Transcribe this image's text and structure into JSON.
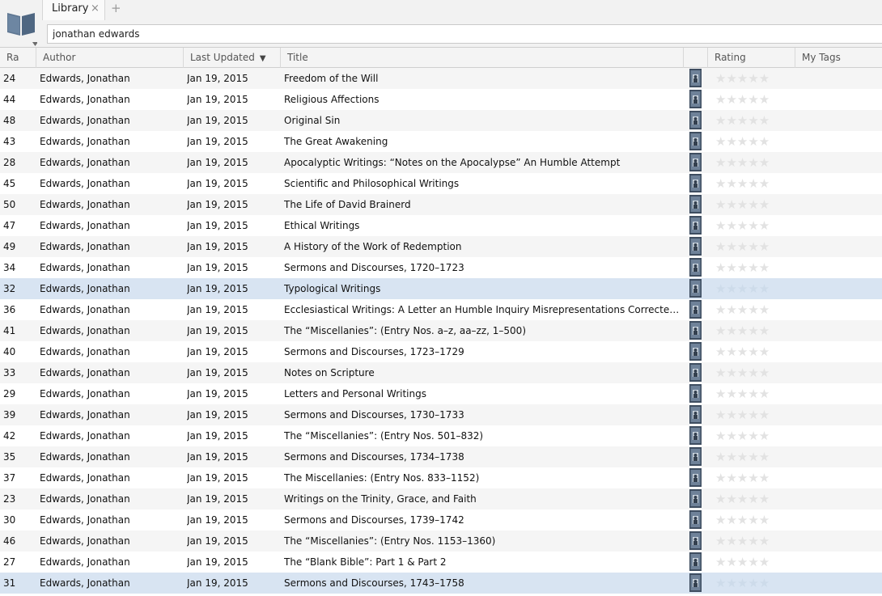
{
  "tabs": [
    {
      "label": "Library",
      "close": "×"
    }
  ],
  "tab_add": "+",
  "search": {
    "value": "jonathan edwards",
    "placeholder": ""
  },
  "columns": [
    {
      "key": "rank",
      "label": "Ra"
    },
    {
      "key": "author",
      "label": "Author"
    },
    {
      "key": "updated",
      "label": "Last Updated",
      "sort": "▼"
    },
    {
      "key": "title",
      "label": "Title"
    },
    {
      "key": "cover",
      "label": ""
    },
    {
      "key": "rating",
      "label": "Rating"
    },
    {
      "key": "tags",
      "label": "My Tags"
    }
  ],
  "stars": "★★★★★",
  "rows": [
    {
      "rank": "24",
      "author": "Edwards, Jonathan",
      "updated": "Jan 19, 2015",
      "title": "Freedom of the Will",
      "selected": false
    },
    {
      "rank": "44",
      "author": "Edwards, Jonathan",
      "updated": "Jan 19, 2015",
      "title": "Religious Affections",
      "selected": false
    },
    {
      "rank": "48",
      "author": "Edwards, Jonathan",
      "updated": "Jan 19, 2015",
      "title": "Original Sin",
      "selected": false
    },
    {
      "rank": "43",
      "author": "Edwards, Jonathan",
      "updated": "Jan 19, 2015",
      "title": "The Great Awakening",
      "selected": false
    },
    {
      "rank": "28",
      "author": "Edwards, Jonathan",
      "updated": "Jan 19, 2015",
      "title": "Apocalyptic Writings: “Notes on the Apocalypse” An Humble Attempt",
      "selected": false
    },
    {
      "rank": "45",
      "author": "Edwards, Jonathan",
      "updated": "Jan 19, 2015",
      "title": "Scientific and Philosophical Writings",
      "selected": false
    },
    {
      "rank": "50",
      "author": "Edwards, Jonathan",
      "updated": "Jan 19, 2015",
      "title": "The Life of David Brainerd",
      "selected": false
    },
    {
      "rank": "47",
      "author": "Edwards, Jonathan",
      "updated": "Jan 19, 2015",
      "title": "Ethical Writings",
      "selected": false
    },
    {
      "rank": "49",
      "author": "Edwards, Jonathan",
      "updated": "Jan 19, 2015",
      "title": "A History of the Work of Redemption",
      "selected": false
    },
    {
      "rank": "34",
      "author": "Edwards, Jonathan",
      "updated": "Jan 19, 2015",
      "title": "Sermons and Discourses, 1720–1723",
      "selected": false
    },
    {
      "rank": "32",
      "author": "Edwards, Jonathan",
      "updated": "Jan 19, 2015",
      "title": "Typological Writings",
      "selected": true
    },
    {
      "rank": "36",
      "author": "Edwards, Jonathan",
      "updated": "Jan 19, 2015",
      "title": "Ecclesiastical Writings: A Letter an Humble Inquiry Misrepresentations Corrected “Narrat…",
      "selected": false
    },
    {
      "rank": "41",
      "author": "Edwards, Jonathan",
      "updated": "Jan 19, 2015",
      "title": "The “Miscellanies”: (Entry Nos. a–z, aa–zz, 1–500)",
      "selected": false
    },
    {
      "rank": "40",
      "author": "Edwards, Jonathan",
      "updated": "Jan 19, 2015",
      "title": "Sermons and Discourses, 1723–1729",
      "selected": false
    },
    {
      "rank": "33",
      "author": "Edwards, Jonathan",
      "updated": "Jan 19, 2015",
      "title": "Notes on Scripture",
      "selected": false
    },
    {
      "rank": "29",
      "author": "Edwards, Jonathan",
      "updated": "Jan 19, 2015",
      "title": "Letters and Personal Writings",
      "selected": false
    },
    {
      "rank": "39",
      "author": "Edwards, Jonathan",
      "updated": "Jan 19, 2015",
      "title": "Sermons and Discourses, 1730–1733",
      "selected": false
    },
    {
      "rank": "42",
      "author": "Edwards, Jonathan",
      "updated": "Jan 19, 2015",
      "title": "The “Miscellanies”: (Entry Nos. 501–832)",
      "selected": false
    },
    {
      "rank": "35",
      "author": "Edwards, Jonathan",
      "updated": "Jan 19, 2015",
      "title": "Sermons and Discourses, 1734–1738",
      "selected": false
    },
    {
      "rank": "37",
      "author": "Edwards, Jonathan",
      "updated": "Jan 19, 2015",
      "title": "The Miscellanies: (Entry Nos. 833–1152)",
      "selected": false
    },
    {
      "rank": "23",
      "author": "Edwards, Jonathan",
      "updated": "Jan 19, 2015",
      "title": "Writings on the Trinity, Grace, and Faith",
      "selected": false
    },
    {
      "rank": "30",
      "author": "Edwards, Jonathan",
      "updated": "Jan 19, 2015",
      "title": "Sermons and Discourses, 1739–1742",
      "selected": false
    },
    {
      "rank": "46",
      "author": "Edwards, Jonathan",
      "updated": "Jan 19, 2015",
      "title": "The “Miscellanies”: (Entry Nos. 1153–1360)",
      "selected": false
    },
    {
      "rank": "27",
      "author": "Edwards, Jonathan",
      "updated": "Jan 19, 2015",
      "title": "The “Blank Bible”: Part 1 & Part 2",
      "selected": false
    },
    {
      "rank": "31",
      "author": "Edwards, Jonathan",
      "updated": "Jan 19, 2015",
      "title": "Sermons and Discourses, 1743–1758",
      "selected": true
    }
  ],
  "colors": {
    "accent_logo": "#4f6782",
    "selected_row": "#d8e4f2",
    "cover_frame": "#3e4d60"
  },
  "icons": {
    "logo": "open-book-icon",
    "tab_close": "close-icon",
    "tab_add": "plus-icon",
    "sort": "triangle-down-icon",
    "cover": "book-cover-thumbnail",
    "rating": "star-icon"
  }
}
